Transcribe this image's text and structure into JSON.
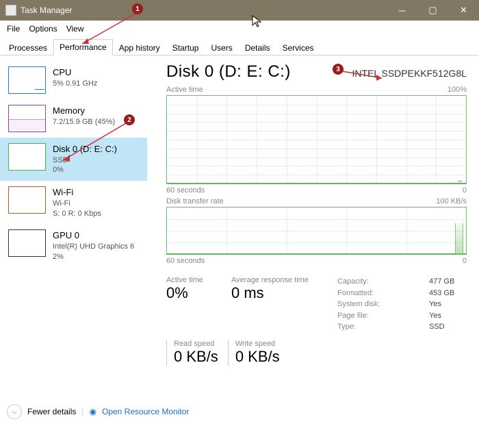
{
  "window": {
    "title": "Task Manager"
  },
  "menu": {
    "file": "File",
    "options": "Options",
    "view": "View"
  },
  "tabs": {
    "processes": "Processes",
    "performance": "Performance",
    "app_history": "App history",
    "startup": "Startup",
    "users": "Users",
    "details": "Details",
    "services": "Services"
  },
  "sidebar": {
    "cpu": {
      "title": "CPU",
      "sub": "5%  0.91 GHz"
    },
    "mem": {
      "title": "Memory",
      "sub": "7.2/15.9 GB (45%)"
    },
    "disk": {
      "title": "Disk 0 (D: E: C:)",
      "sub1": "SSD",
      "sub2": "0%"
    },
    "wifi": {
      "title": "Wi-Fi",
      "sub1": "Wi-Fi",
      "sub2": "S: 0  R: 0 Kbps"
    },
    "gpu": {
      "title": "GPU 0",
      "sub1": "Intel(R) UHD Graphics 6",
      "sub2": "2%"
    }
  },
  "detail": {
    "title": "Disk 0 (D: E: C:)",
    "model": "INTEL SSDPEKKF512G8L",
    "chart1_label": "Active time",
    "chart1_max": "100%",
    "chart2_label": "Disk transfer rate",
    "chart2_max": "100 KB/s",
    "axis_left": "60 seconds",
    "axis_right": "0",
    "stats": {
      "active_time_label": "Active time",
      "active_time": "0%",
      "avg_resp_label": "Average response time",
      "avg_resp": "0 ms",
      "read_label": "Read speed",
      "read": "0 KB/s",
      "write_label": "Write speed",
      "write": "0 KB/s",
      "capacity_k": "Capacity:",
      "capacity_v": "477 GB",
      "formatted_k": "Formatted:",
      "formatted_v": "453 GB",
      "system_k": "System disk:",
      "system_v": "Yes",
      "page_k": "Page file:",
      "page_v": "Yes",
      "type_k": "Type:",
      "type_v": "SSD"
    }
  },
  "footer": {
    "fewer": "Fewer details",
    "orm": "Open Resource Monitor"
  },
  "chart_data": [
    {
      "type": "line",
      "title": "Active time",
      "ylabel": "%",
      "ylim": [
        0,
        100
      ],
      "xrange_seconds": [
        60,
        0
      ],
      "series": [
        {
          "name": "Active time",
          "values_percent_over_time": "flat ~0% with minor blip near t=0"
        }
      ]
    },
    {
      "type": "line",
      "title": "Disk transfer rate",
      "ylabel": "KB/s",
      "ylim": [
        0,
        100
      ],
      "xrange_seconds": [
        60,
        0
      ],
      "series": [
        {
          "name": "Transfer rate",
          "values_kbps_over_time": "flat ~0 with spike to ~60-70 near t=0"
        }
      ]
    }
  ],
  "annotations": {
    "a1": "1",
    "a2": "2",
    "a3": "3"
  }
}
